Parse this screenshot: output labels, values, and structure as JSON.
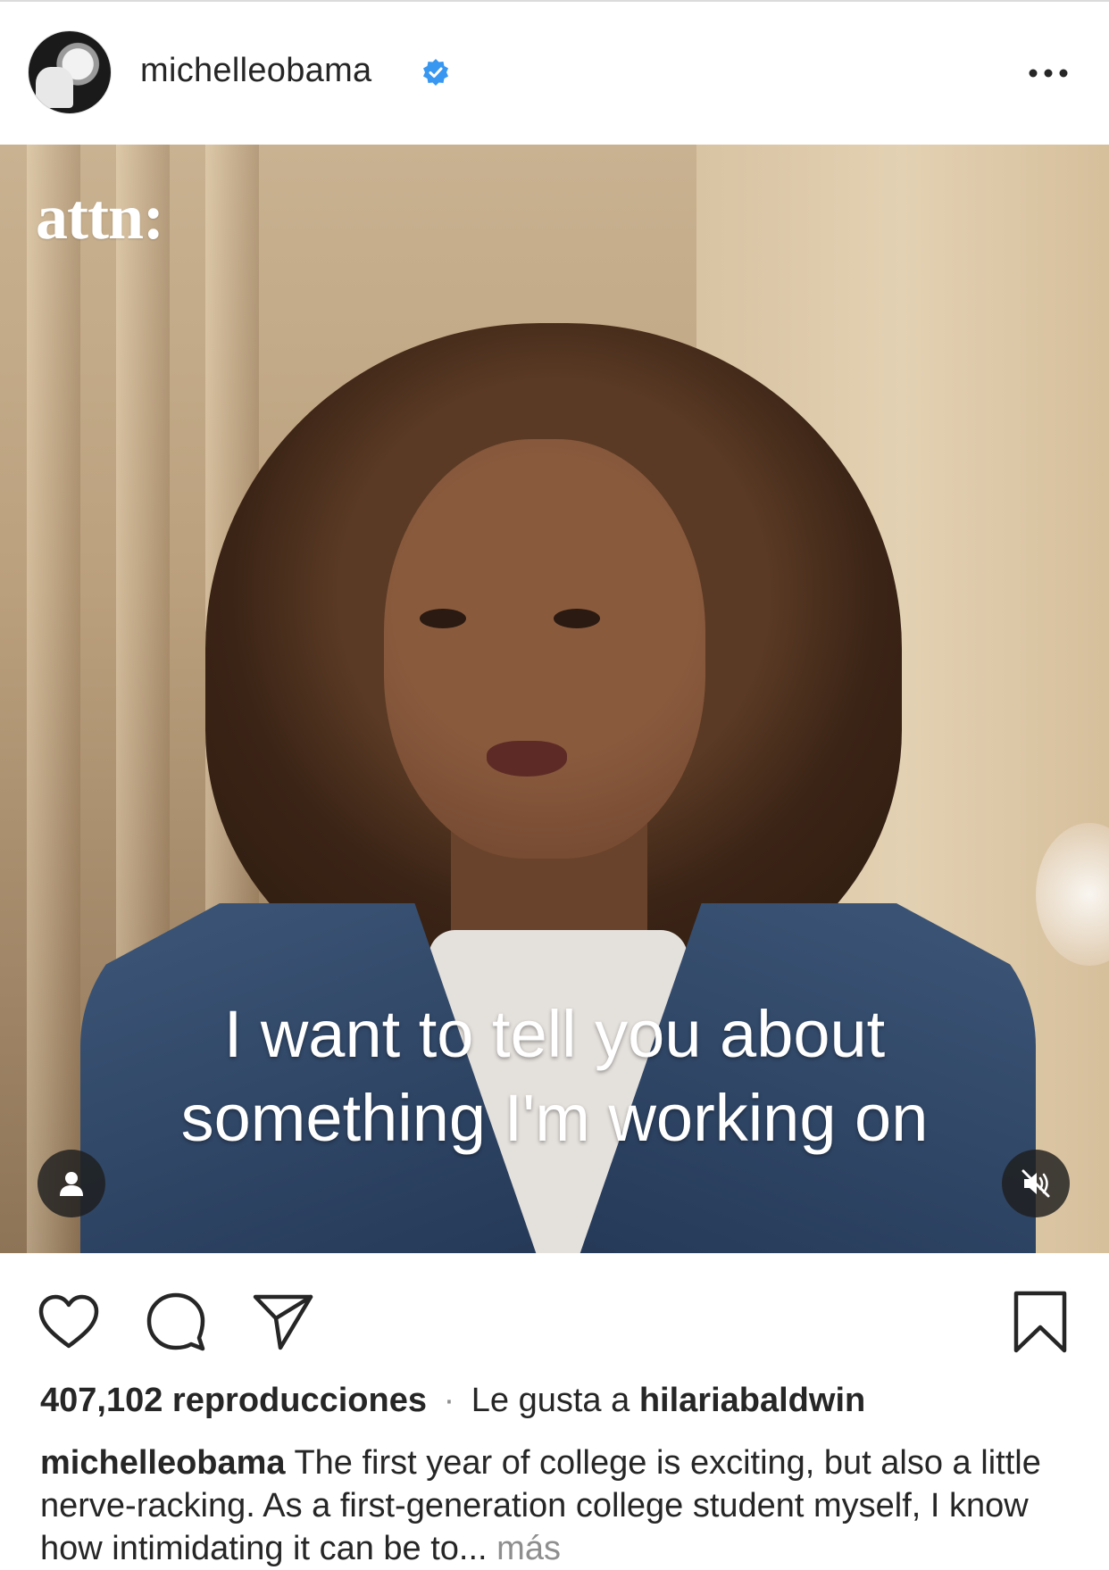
{
  "post": {
    "username": "michelleobama",
    "verified": true,
    "more_icon": "more-horizontal-icon"
  },
  "media": {
    "brand_logo": "attn:",
    "subtitle_line1": "I want to tell you about",
    "subtitle_line2": "something I'm working on",
    "tag_icon": "person-tag-icon",
    "mute_icon": "speaker-muted-icon"
  },
  "actions": {
    "like_icon": "heart-icon",
    "comment_icon": "comment-bubble-icon",
    "share_icon": "send-paper-plane-icon",
    "save_icon": "bookmark-icon"
  },
  "stats": {
    "views": "407,102 reproducciones",
    "separator": "·",
    "liked_by_prefix": "Le gusta a",
    "liked_by_user": "hilariabaldwin"
  },
  "caption": {
    "username": "michelleobama",
    "text": "The first year of college is exciting, but also a little nerve-racking. As a first-generation college student myself, I know how intimidating it can be to...",
    "more_label": "más"
  },
  "colors": {
    "text": "#262626",
    "muted": "#8e8e8e",
    "verified_blue": "#3897f0",
    "border": "#dbdbdb"
  }
}
